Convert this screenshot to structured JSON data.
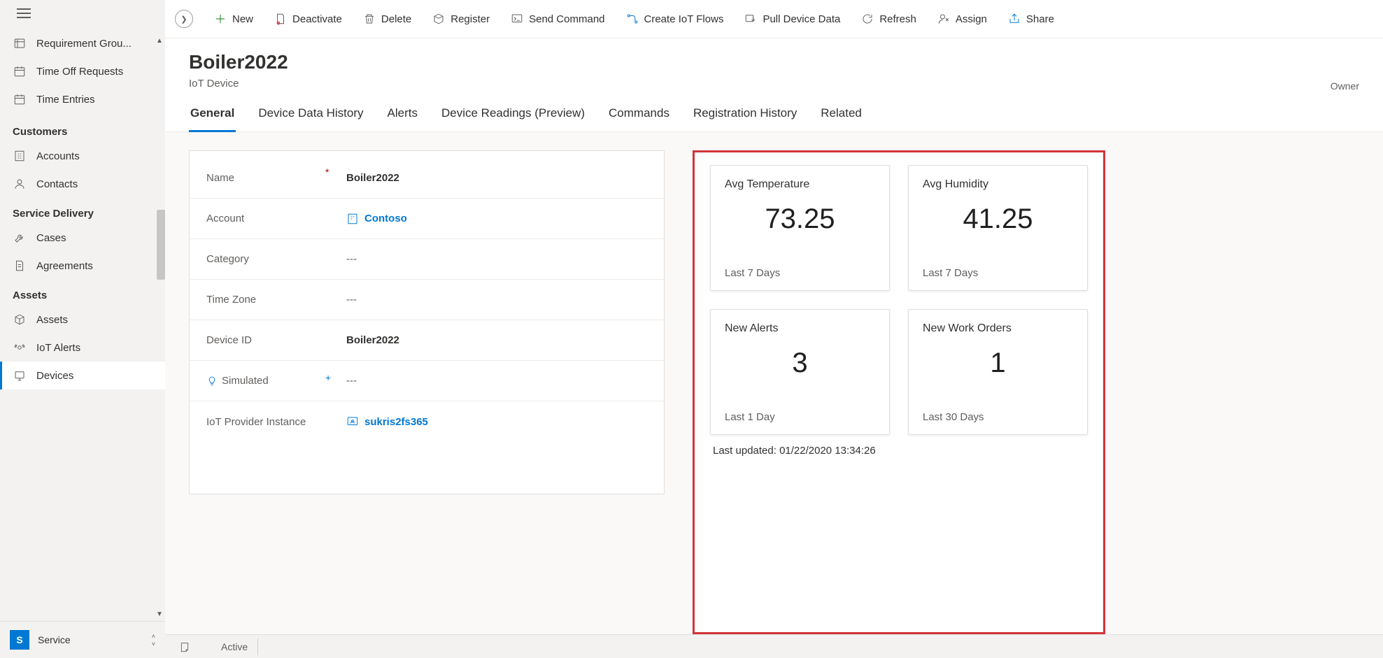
{
  "sidebar": {
    "items_top": [
      {
        "label": "Requirement Grou..."
      },
      {
        "label": "Time Off Requests"
      },
      {
        "label": "Time Entries"
      }
    ],
    "sections": [
      {
        "title": "Customers",
        "items": [
          {
            "label": "Accounts"
          },
          {
            "label": "Contacts"
          }
        ]
      },
      {
        "title": "Service Delivery",
        "items": [
          {
            "label": "Cases"
          },
          {
            "label": "Agreements"
          }
        ]
      },
      {
        "title": "Assets",
        "items": [
          {
            "label": "Assets"
          },
          {
            "label": "IoT Alerts"
          },
          {
            "label": "Devices"
          }
        ]
      }
    ],
    "footer": {
      "badge": "S",
      "label": "Service"
    }
  },
  "commands": {
    "new": "New",
    "deactivate": "Deactivate",
    "delete": "Delete",
    "register": "Register",
    "send_command": "Send Command",
    "create_flows": "Create IoT Flows",
    "pull_data": "Pull Device Data",
    "refresh": "Refresh",
    "assign": "Assign",
    "share": "Share"
  },
  "header": {
    "title": "Boiler2022",
    "subtitle": "IoT Device",
    "owner": "Owner"
  },
  "tabs": [
    "General",
    "Device Data History",
    "Alerts",
    "Device Readings (Preview)",
    "Commands",
    "Registration History",
    "Related"
  ],
  "form": {
    "name": {
      "label": "Name",
      "value": "Boiler2022"
    },
    "account": {
      "label": "Account",
      "value": "Contoso"
    },
    "category": {
      "label": "Category",
      "value": "---"
    },
    "timezone": {
      "label": "Time Zone",
      "value": "---"
    },
    "device_id": {
      "label": "Device ID",
      "value": "Boiler2022"
    },
    "simulated": {
      "label": "Simulated",
      "value": "---"
    },
    "provider": {
      "label": "IoT Provider Instance",
      "value": "sukris2fs365"
    }
  },
  "dashboard": {
    "cards": [
      {
        "title": "Avg Temperature",
        "value": "73.25",
        "period": "Last 7 Days"
      },
      {
        "title": "Avg Humidity",
        "value": "41.25",
        "period": "Last 7 Days"
      },
      {
        "title": "New Alerts",
        "value": "3",
        "period": "Last 1 Day"
      },
      {
        "title": "New Work Orders",
        "value": "1",
        "period": "Last 30 Days"
      }
    ],
    "last_updated": "Last updated: 01/22/2020 13:34:26"
  },
  "statusbar": {
    "active": "Active"
  }
}
